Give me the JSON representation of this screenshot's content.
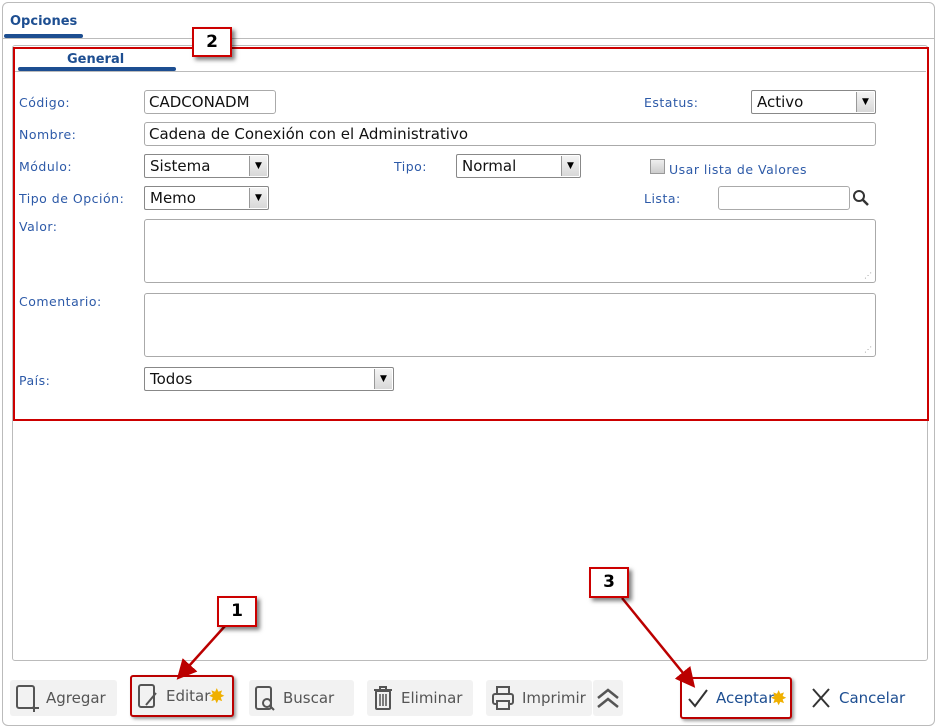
{
  "tabs": {
    "main": "Opciones",
    "sub": "General"
  },
  "form": {
    "codigo_label": "Código:",
    "codigo": "CADCONADM",
    "estatus_label": "Estatus:",
    "estatus": "Activo",
    "nombre_label": "Nombre:",
    "nombre": "Cadena de Conexión con el Administrativo",
    "modulo_label": "Módulo:",
    "modulo": "Sistema",
    "tipo_label": "Tipo:",
    "tipo": "Normal",
    "usar_lista_label": "Usar lista de Valores",
    "usar_lista": false,
    "tipo_opcion_label": "Tipo de Opción:",
    "tipo_opcion": "Memo",
    "lista_label": "Lista:",
    "lista": "",
    "valor_label": "Valor:",
    "valor": "",
    "comentario_label": "Comentario:",
    "comentario": "",
    "pais_label": "País:",
    "pais": "Todos"
  },
  "callouts": [
    "1",
    "2",
    "3"
  ],
  "toolbar": {
    "agregar": "Agregar",
    "editar": "Editar",
    "buscar": "Buscar",
    "eliminar": "Eliminar",
    "imprimir": "Imprimir",
    "aceptar": "Aceptar",
    "cancelar": "Cancelar"
  },
  "colors": {
    "accent": "#1d4e91",
    "annotation": "#cc0000"
  }
}
